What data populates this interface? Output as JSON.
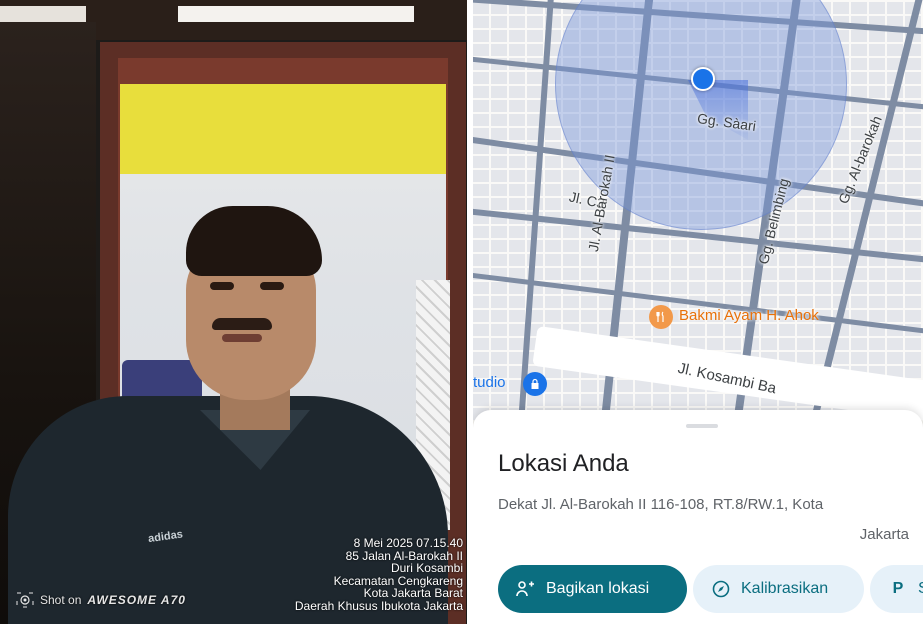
{
  "photo": {
    "timestamp_lines": [
      "8 Mei 2025 07.15.40",
      "85 Jalan Al-Barokah II",
      "Duri Kosambi",
      "Kecamatan Cengkareng",
      "Kota Jakarta Barat",
      "Daerah Khusus Ibukota Jakarta"
    ],
    "watermark": {
      "prefix": "Shot on",
      "brand": "AWESOME A70",
      "icon": "camera-lens-icon"
    },
    "shirt_logo": "adidas"
  },
  "map": {
    "street_labels": {
      "gg_saari": "Gg. Sàari",
      "jl_c3": "Jl. C3",
      "al_barokah_2": "Jl. Al-Barokah II",
      "belimbing": "Gg. Belimbing",
      "gg_al_barokah": "Gg. Al-barokah",
      "kosambi": "Jl. Kosambi Ba"
    },
    "poi": {
      "label": "Bakmi Ayam H. Ahok",
      "icon": "restaurant-icon",
      "color": "#f2994a"
    },
    "studio_label": "tudio",
    "location_color": "#1a73e8"
  },
  "sheet": {
    "title": "Lokasi Anda",
    "address_line1": "Dekat Jl. Al-Barokah II 116-108, RT.8/RW.1, Kota",
    "address_line2": "Jakarta",
    "buttons": {
      "share": {
        "label": "Bagikan lokasi",
        "icon": "share-location-icon"
      },
      "calibrate": {
        "label": "Kalibrasikan",
        "icon": "compass-icon"
      },
      "parking": {
        "label": "S",
        "icon": "parking-icon",
        "icon_text": "P"
      }
    }
  },
  "colors": {
    "accent": "#0b6e80",
    "chip_bg": "#e6f1f9"
  }
}
